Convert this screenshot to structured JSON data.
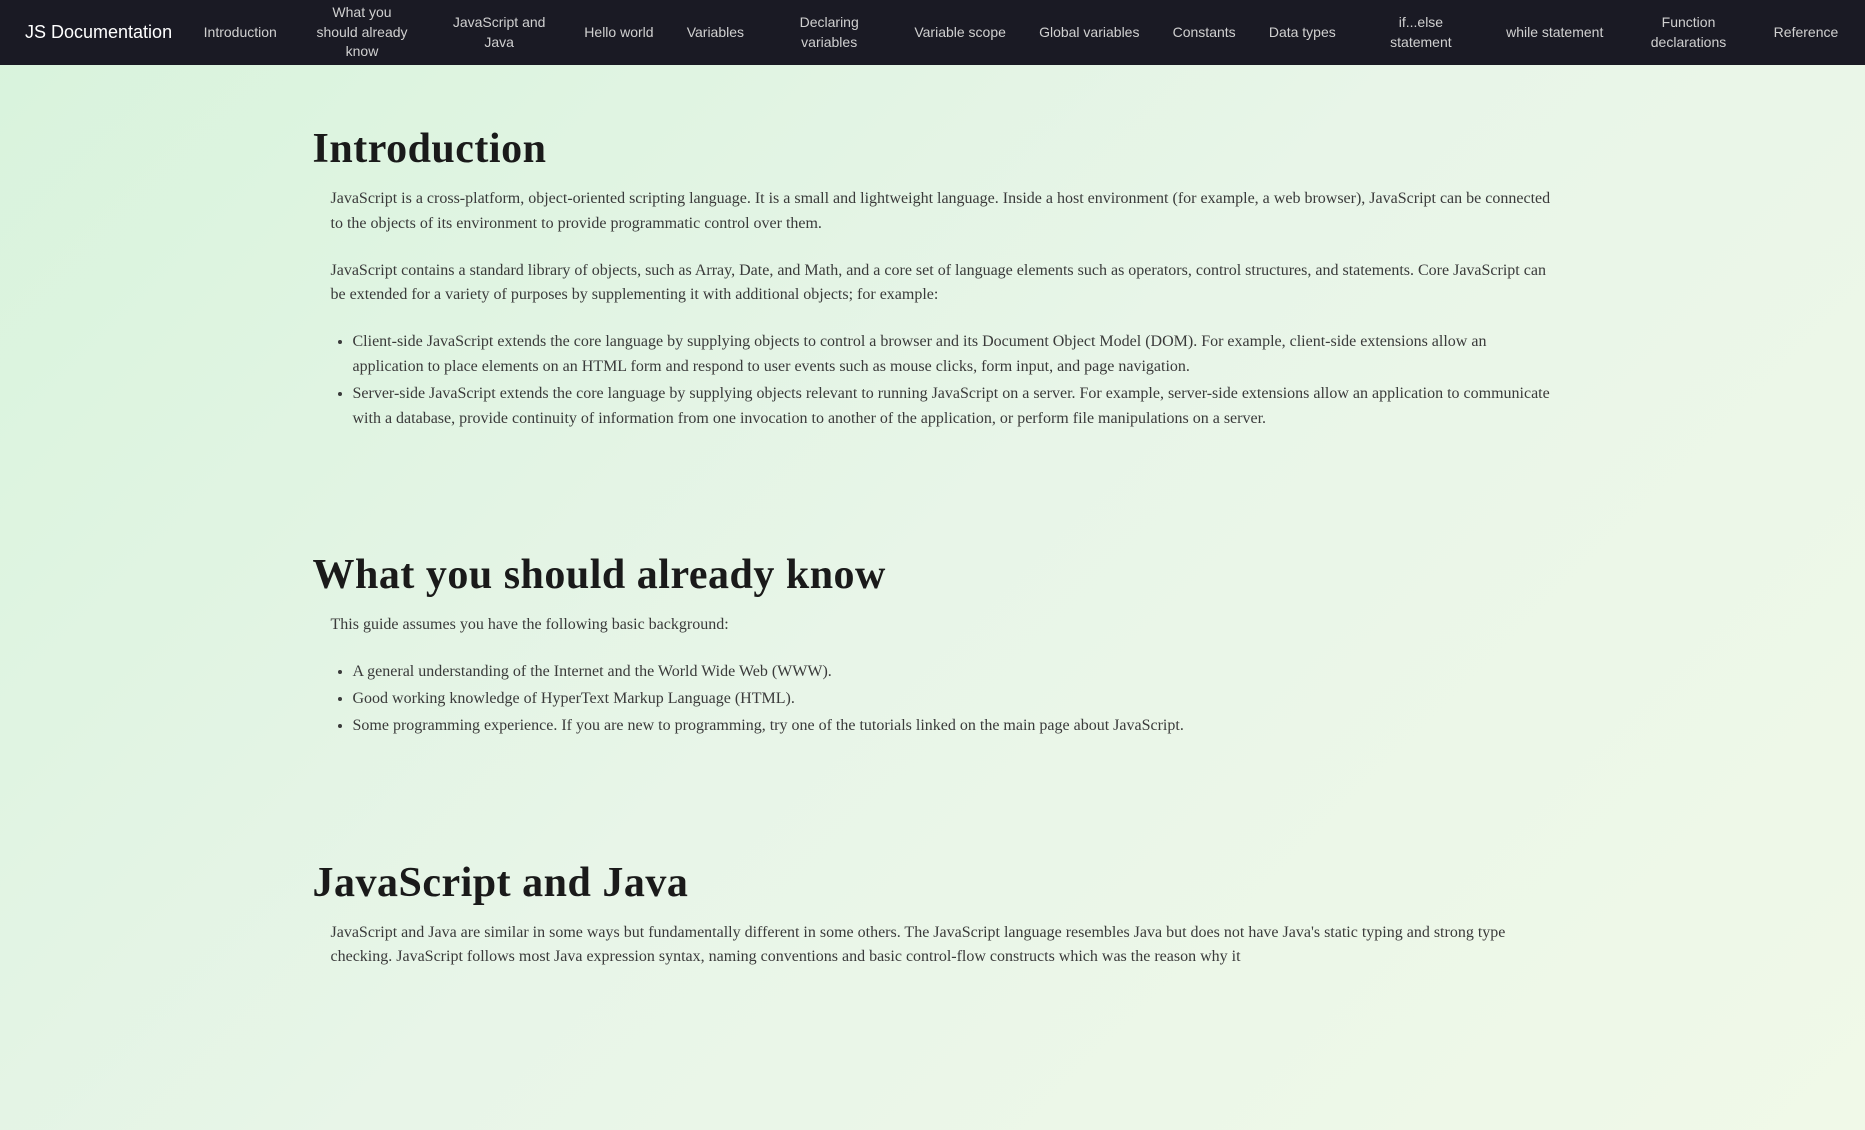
{
  "nav": {
    "title": "JS Documentation",
    "links": [
      "Introduction",
      "What you should already know",
      "JavaScript and Java",
      "Hello world",
      "Variables",
      "Declaring variables",
      "Variable scope",
      "Global variables",
      "Constants",
      "Data types",
      "if...else statement",
      "while statement",
      "Function declarations",
      "Reference"
    ]
  },
  "sections": {
    "introduction": {
      "heading": "Introduction",
      "p1": "JavaScript is a cross-platform, object-oriented scripting language. It is a small and lightweight language. Inside a host environment (for example, a web browser), JavaScript can be connected to the objects of its environment to provide programmatic control over them.",
      "p2": "JavaScript contains a standard library of objects, such as Array, Date, and Math, and a core set of language elements such as operators, control structures, and statements. Core JavaScript can be extended for a variety of purposes by supplementing it with additional objects; for example:",
      "li1": "Client-side JavaScript extends the core language by supplying objects to control a browser and its Document Object Model (DOM). For example, client-side extensions allow an application to place elements on an HTML form and respond to user events such as mouse clicks, form input, and page navigation.",
      "li2": "Server-side JavaScript extends the core language by supplying objects relevant to running JavaScript on a server. For example, server-side extensions allow an application to communicate with a database, provide continuity of information from one invocation to another of the application, or perform file manipulations on a server."
    },
    "already_know": {
      "heading": "What you should already know",
      "p1": "This guide assumes you have the following basic background:",
      "li1": "A general understanding of the Internet and the World Wide Web (WWW).",
      "li2": "Good working knowledge of HyperText Markup Language (HTML).",
      "li3": "Some programming experience. If you are new to programming, try one of the tutorials linked on the main page about JavaScript."
    },
    "js_and_java": {
      "heading": "JavaScript and Java",
      "p1": "JavaScript and Java are similar in some ways but fundamentally different in some others. The JavaScript language resembles Java but does not have Java's static typing and strong type checking. JavaScript follows most Java expression syntax, naming conventions and basic control-flow constructs which was the reason why it"
    }
  }
}
